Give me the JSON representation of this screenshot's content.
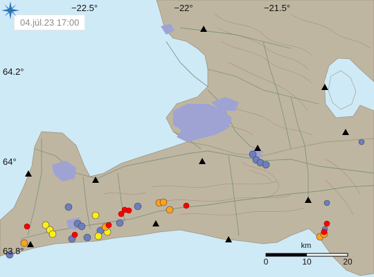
{
  "timestamp": "04.júl.23  17:00",
  "lon_labels": [
    "−22.5°",
    "−22°",
    "−21.5°"
  ],
  "lat_labels": [
    "64.2°",
    "64°",
    "63.8°"
  ],
  "scale": {
    "unit": "km",
    "ticks": [
      "0",
      "10",
      "20"
    ]
  },
  "logo_icon": "vedur-star-icon",
  "colors": {
    "sea": "#cfeaf7",
    "land": "#bfb6a1",
    "urban": "#9ea3d3",
    "roads": "#7f9280",
    "contours": "#a48d7a",
    "eq_red": "#ff0000",
    "eq_orange": "#ffa21a",
    "eq_yellow": "#fcef18",
    "eq_blue": "#6b7fc0"
  },
  "earthquake_legend_note": "colors by age",
  "station_icon": "triangle-icon"
}
